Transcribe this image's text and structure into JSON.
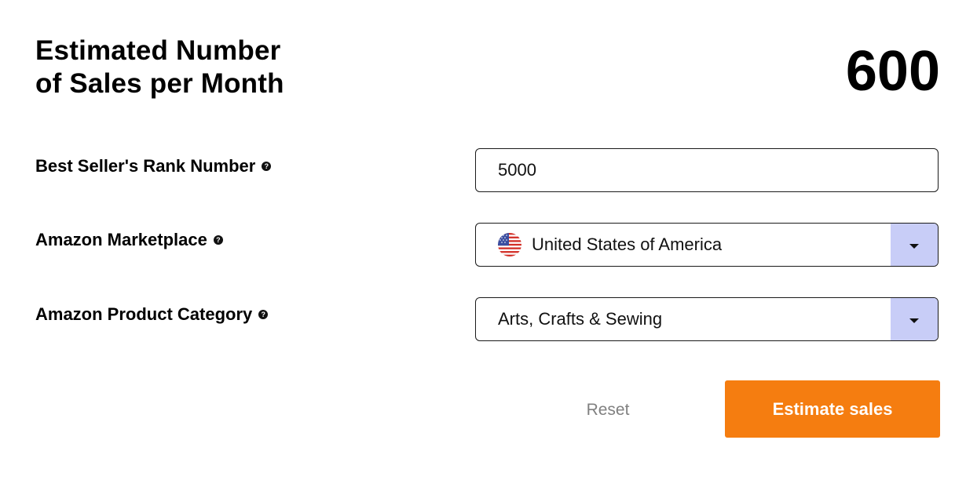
{
  "header": {
    "title_line1": "Estimated Number",
    "title_line2": "of Sales per Month",
    "result_value": "600"
  },
  "form": {
    "rank": {
      "label": "Best Seller's Rank Number",
      "help_icon": "question-circle-icon",
      "value": "5000"
    },
    "marketplace": {
      "label": "Amazon Marketplace",
      "help_icon": "question-circle-icon",
      "flag_icon": "us-flag-icon",
      "value": "United States of America"
    },
    "category": {
      "label": "Amazon Product Category",
      "help_icon": "question-circle-icon",
      "value": "Arts, Crafts & Sewing"
    }
  },
  "actions": {
    "reset_label": "Reset",
    "estimate_label": "Estimate sales"
  },
  "colors": {
    "accent_orange": "#f57d10",
    "dropdown_button_bg": "#c8cdf7",
    "reset_text": "#808080"
  }
}
